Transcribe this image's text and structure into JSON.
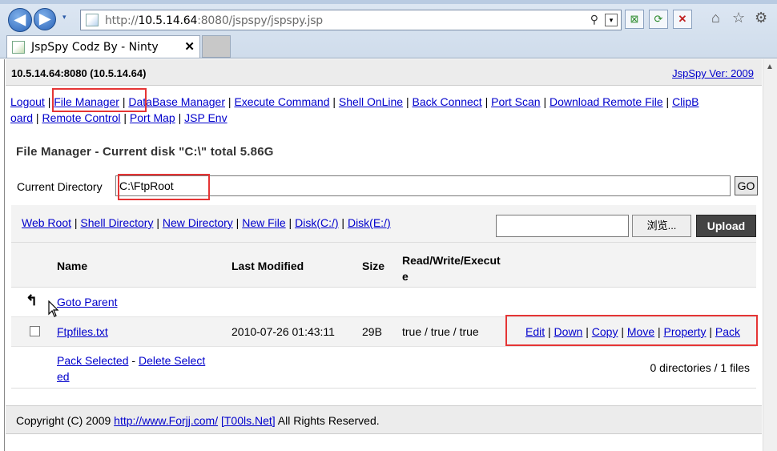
{
  "browser": {
    "url_prefix": "http://",
    "url_host": "10.5.14.64",
    "url_rest": ":8080/jspspy/jspspy.jsp",
    "search_glyph": "⚲",
    "tab_title": "JspSpy Codz By - Ninty",
    "tab_close": "✕",
    "home_glyph": "⌂",
    "star_glyph": "☆",
    "gear_glyph": "⚙",
    "back_glyph": "◀",
    "forward_glyph": "▶",
    "dropdown_glyph": "▾"
  },
  "header": {
    "host": "10.5.14.64:8080 (10.5.14.64)",
    "version_link": "JspSpy Ver: 2009"
  },
  "menu": {
    "items": [
      "Logout",
      "File Manager",
      "DataBase Manager",
      "Execute Command",
      "Shell OnLine",
      "Back Connect",
      "Port Scan",
      "Download Remote File",
      "ClipB",
      "oard",
      "Remote Control",
      "Port Map",
      "JSP Env"
    ],
    "separator": " | "
  },
  "file_manager": {
    "title": "File Manager - Current disk \"C:\\\" total 5.86G",
    "current_dir_label": "Current Directory",
    "current_dir_value": "C:\\FtpRoot",
    "go_label": "GO",
    "tool_links": [
      "Web Root",
      "Shell Directory",
      "New Directory",
      "New File",
      "Disk(C:/)",
      "Disk(E:/)"
    ],
    "browse_label": "浏览...",
    "upload_label": "Upload",
    "columns": {
      "name": "Name",
      "modified": "Last Modified",
      "size": "Size",
      "rwx_line1": "Read/Write/Execut",
      "rwx_line2": "e"
    },
    "parent_icon": "↰",
    "goto_parent": "Goto Parent",
    "files": [
      {
        "name": "Ftpfiles.txt",
        "modified": "2010-07-26 01:43:11",
        "size": "29B",
        "rwx": "true / true / true",
        "actions": [
          "Edit",
          "Down",
          "Copy",
          "Move",
          "Property",
          "Pack"
        ]
      }
    ],
    "pack_selected": "Pack Selected",
    "dash": " - ",
    "delete_selected_1": "Delete Select",
    "delete_selected_2": "ed",
    "counts": "0 directories / 1 files"
  },
  "footer": {
    "prefix": "Copyright (C) 2009 ",
    "link1": "http://www.Forjj.com/",
    "link2": "[T00ls.Net]",
    "suffix": " All Rights Reserved."
  },
  "colors": {
    "link": "#0000cc",
    "highlight": "#e53535",
    "header_bg": "#ececec",
    "row_alt_bg": "#f3f3f3",
    "upload_bg": "#444444"
  }
}
